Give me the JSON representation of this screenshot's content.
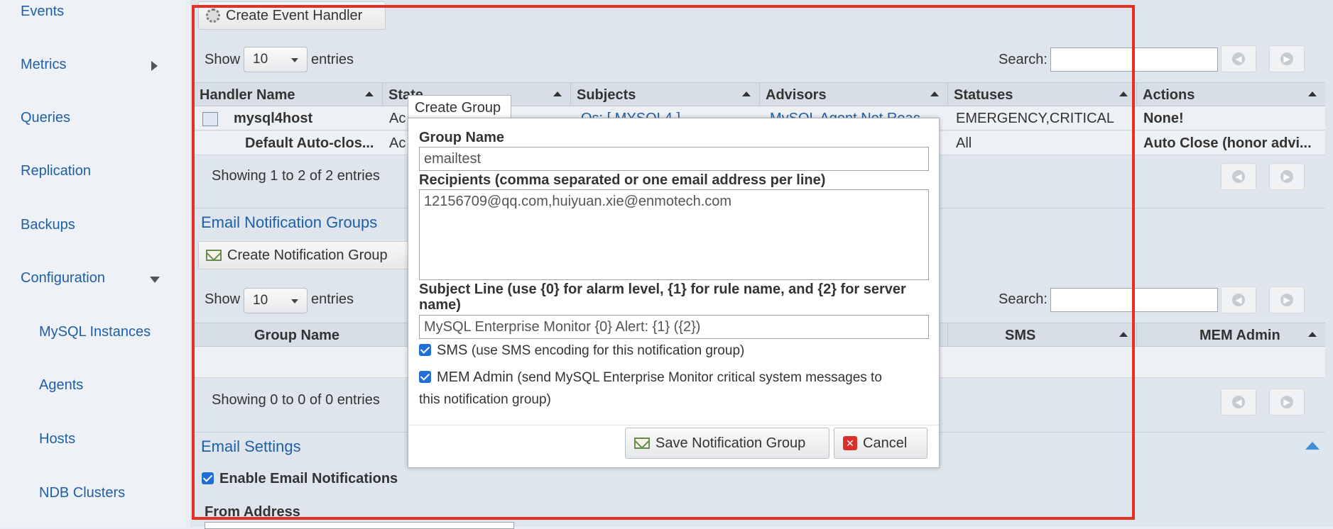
{
  "sidebar": {
    "items": [
      {
        "label": "Events"
      },
      {
        "label": "Metrics"
      },
      {
        "label": "Queries"
      },
      {
        "label": "Replication"
      },
      {
        "label": "Backups"
      },
      {
        "label": "Configuration"
      },
      {
        "label": "MySQL Instances"
      },
      {
        "label": "Agents"
      },
      {
        "label": "Hosts"
      },
      {
        "label": "NDB Clusters"
      }
    ]
  },
  "event_handlers": {
    "create_button": "Create Event Handler",
    "show_label": "Show",
    "page_size": "10",
    "entries_label": "entries",
    "search_label": "Search:",
    "columns": [
      "Handler Name",
      "State",
      "Subjects",
      "Advisors",
      "Statuses",
      "Actions"
    ],
    "rows": [
      {
        "name": "mysql4host",
        "state": "Ac",
        "subjects": "Os: [ MYSQL4 ]",
        "advisors": "MySQL Agent Not Reac...",
        "statuses": "EMERGENCY,CRITICAL",
        "actions": "None!"
      },
      {
        "name": "Default Auto-clos...",
        "state": "Ac",
        "subjects": "",
        "advisors": "",
        "statuses": "All",
        "actions": "Auto Close (honor advi..."
      }
    ],
    "summary": "Showing 1 to 2 of 2 entries"
  },
  "notification_groups": {
    "title": "Email Notification Groups",
    "create_button": "Create Notification Group",
    "show_label": "Show",
    "page_size": "10",
    "entries_label": "entries",
    "search_label": "Search:",
    "columns": [
      "Group Name",
      "SMS",
      "MEM Admin"
    ],
    "summary": "Showing 0 to 0 of 0 entries"
  },
  "email_settings": {
    "title": "Email Settings",
    "enable_label": "Enable Email Notifications",
    "from_label": "From Address"
  },
  "dialog": {
    "title": "Create Group",
    "group_name_label": "Group Name",
    "group_name_value": "emailtest",
    "recipients_label": "Recipients (comma separated or one email address per line)",
    "recipients_value": "12156709@qq.com,huiyuan.xie@enmotech.com",
    "subject_label_line1": "Subject Line (use {0} for alarm level, {1} for rule name, and {2} for server",
    "subject_label_line2": "name)",
    "subject_value": "MySQL Enterprise Monitor {0} Alert: {1} ({2})",
    "sms_label": "SMS",
    "sms_hint": "(use SMS encoding for this notification group)",
    "mem_label": "MEM Admin",
    "mem_hint_line1": "(send MySQL Enterprise Monitor critical system messages to",
    "mem_hint_line2": "this notification group)",
    "save_button": "Save Notification Group",
    "cancel_button": "Cancel"
  },
  "colors": {
    "highlight_frame": "#e53124",
    "link": "#1f5fa6"
  }
}
